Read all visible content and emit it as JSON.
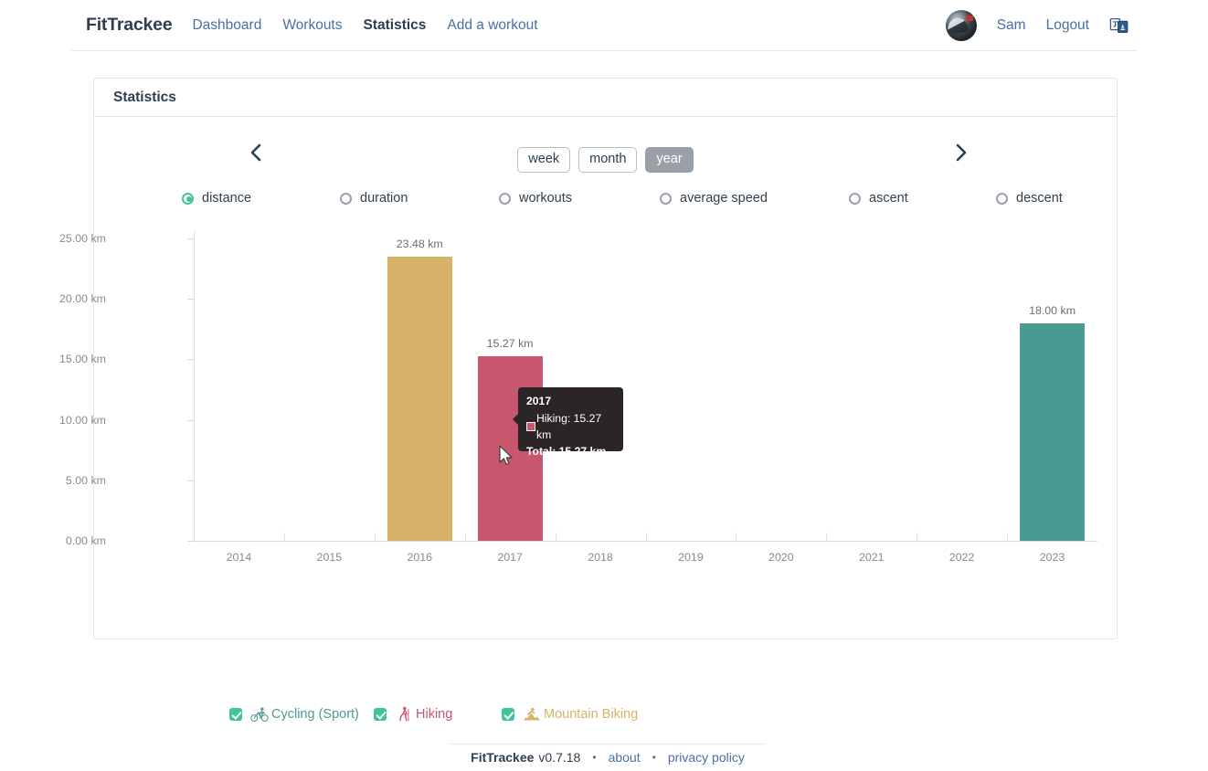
{
  "header": {
    "brand": "FitTrackee",
    "nav": [
      {
        "label": "Dashboard",
        "active": false
      },
      {
        "label": "Workouts",
        "active": false
      },
      {
        "label": "Statistics",
        "active": true
      },
      {
        "label": "Add a workout",
        "active": false
      }
    ],
    "user_name": "Sam",
    "logout_label": "Logout",
    "language_icon": "language-icon",
    "avatar_icon": "user-avatar"
  },
  "card": {
    "title": "Statistics",
    "prev_icon": "chevron-left-icon",
    "next_icon": "chevron-right-icon",
    "periods": [
      {
        "label": "week",
        "active": false
      },
      {
        "label": "month",
        "active": false
      },
      {
        "label": "year",
        "active": true
      }
    ],
    "metrics": [
      {
        "label": "distance",
        "selected": true
      },
      {
        "label": "duration",
        "selected": false
      },
      {
        "label": "workouts",
        "selected": false
      },
      {
        "label": "average speed",
        "selected": false
      },
      {
        "label": "ascent",
        "selected": false
      },
      {
        "label": "descent",
        "selected": false
      }
    ],
    "legend": [
      {
        "label": "Cycling (Sport)",
        "color": "#4b9a92",
        "checked": true,
        "icon": "cycling-icon"
      },
      {
        "label": "Hiking",
        "color": "#c8566d",
        "checked": true,
        "icon": "hiking-icon"
      },
      {
        "label": "Mountain Biking",
        "color": "#d7b269",
        "checked": true,
        "icon": "mountain-biking-icon"
      }
    ]
  },
  "tooltip": {
    "title": "2017",
    "entry_label": "Hiking: 15.27 km",
    "entry_color": "#c8566d",
    "total": "Total: 15.27 km"
  },
  "chart_data": {
    "type": "bar",
    "title": "",
    "xlabel": "",
    "ylabel": "",
    "categories": [
      "2014",
      "2015",
      "2016",
      "2017",
      "2018",
      "2019",
      "2020",
      "2021",
      "2022",
      "2023"
    ],
    "ylim": [
      0,
      25
    ],
    "y_ticks": [
      0,
      5,
      10,
      15,
      20,
      25
    ],
    "y_tick_labels": [
      "0.00 km",
      "5.00 km",
      "10.00 km",
      "15.00 km",
      "20.00 km",
      "25.00 km"
    ],
    "grid": false,
    "legend_position": "bottom",
    "series": [
      {
        "name": "Cycling (Sport)",
        "color": "#4b9a92",
        "values": [
          0,
          0,
          0,
          0,
          0,
          0,
          0,
          0,
          0,
          18.0
        ]
      },
      {
        "name": "Hiking",
        "color": "#c8566d",
        "values": [
          0,
          0,
          0,
          15.27,
          0,
          0,
          0,
          0,
          0,
          0
        ]
      },
      {
        "name": "Mountain Biking",
        "color": "#d7b269",
        "values": [
          0,
          0,
          23.48,
          0,
          0,
          0,
          0,
          0,
          0,
          0
        ]
      }
    ],
    "bar_labels": [
      {
        "category": "2016",
        "text": "23.48 km",
        "value": 23.48
      },
      {
        "category": "2017",
        "text": "15.27 km",
        "value": 15.27
      },
      {
        "category": "2023",
        "text": "18.00 km",
        "value": 18.0
      }
    ]
  },
  "footer": {
    "brand": "FitTrackee",
    "version": "v0.7.18",
    "separator": "•",
    "about_label": "about",
    "privacy_label": "privacy policy"
  }
}
